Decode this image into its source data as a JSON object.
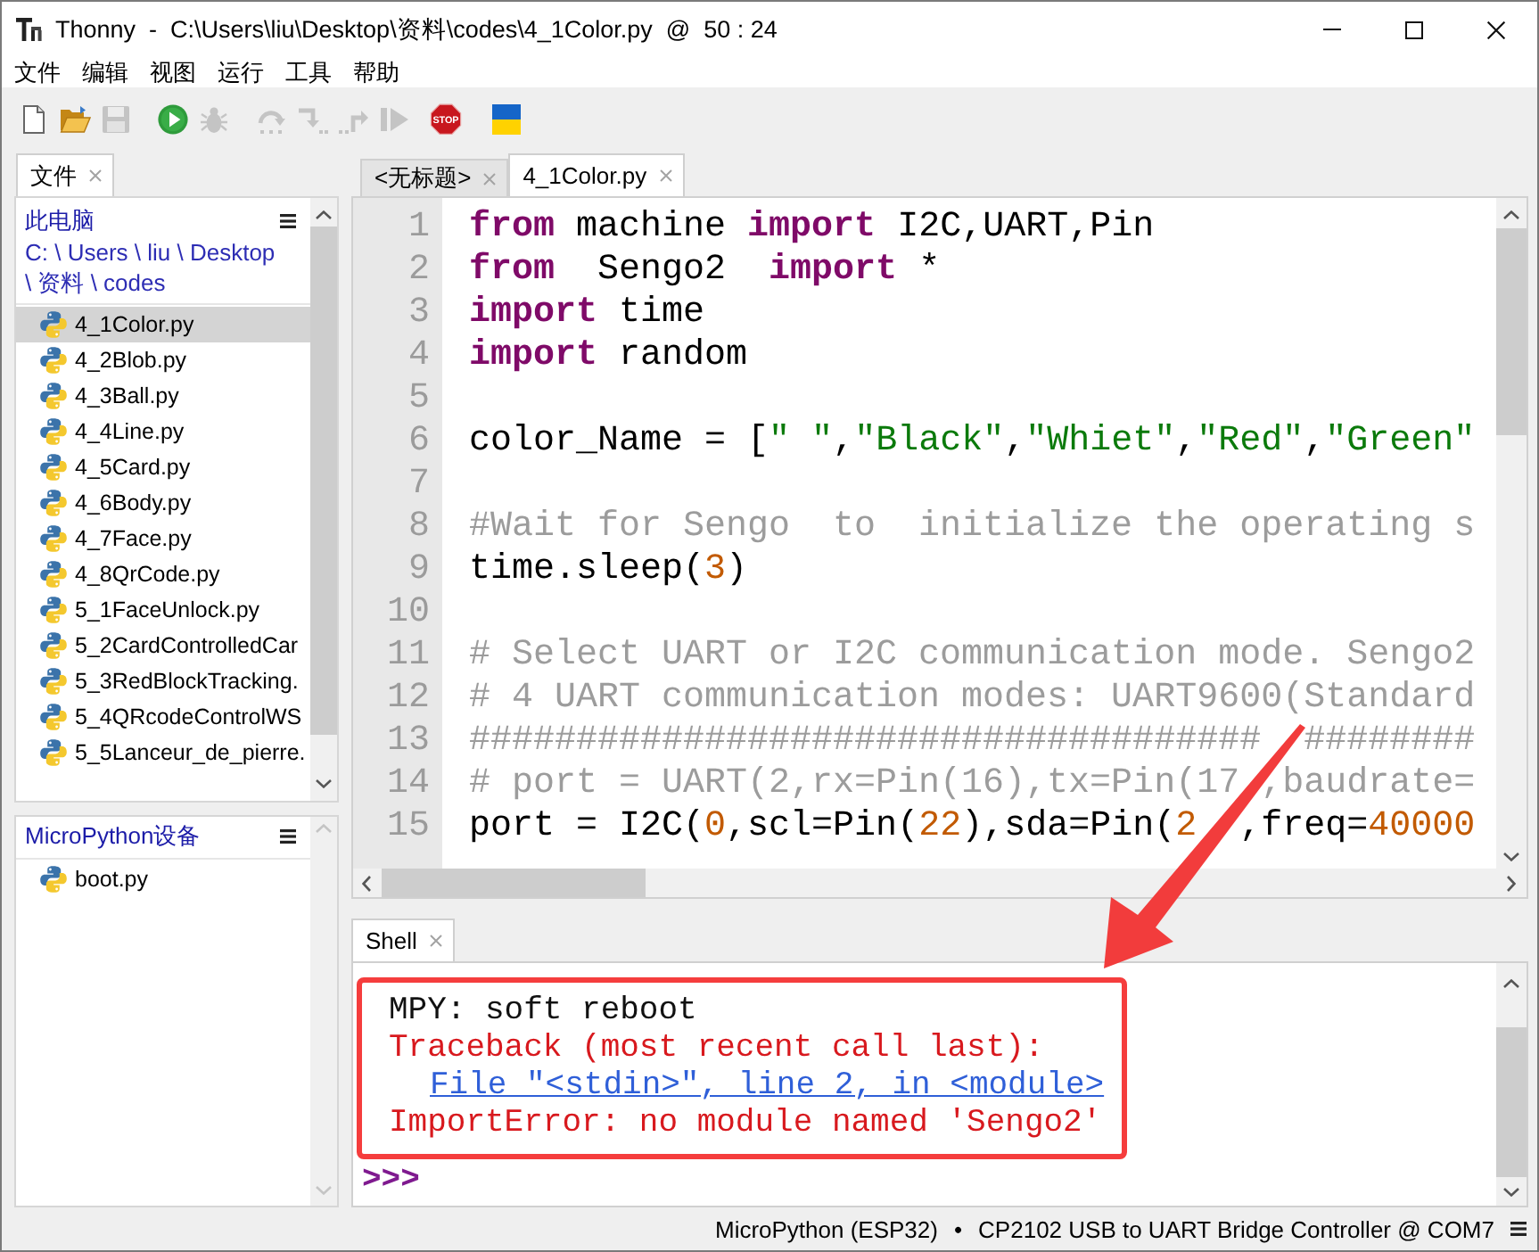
{
  "window": {
    "title": "Thonny  -  C:\\Users\\liu\\Desktop\\资料\\codes\\4_1Color.py  @  50 : 24"
  },
  "menu": [
    "文件",
    "编辑",
    "视图",
    "运行",
    "工具",
    "帮助"
  ],
  "toolbar": [
    {
      "kind": "new",
      "disabled": false
    },
    {
      "kind": "open",
      "disabled": false
    },
    {
      "kind": "save",
      "disabled": true
    },
    {
      "kind": "run",
      "disabled": false
    },
    {
      "kind": "debug",
      "disabled": true
    },
    {
      "kind": "step_over",
      "disabled": true
    },
    {
      "kind": "step_into",
      "disabled": true
    },
    {
      "kind": "step_out",
      "disabled": true
    },
    {
      "kind": "resume",
      "disabled": true
    },
    {
      "kind": "stop",
      "disabled": false,
      "label": "STOP"
    },
    {
      "kind": "flag",
      "disabled": false
    }
  ],
  "files_panel": {
    "tab": {
      "label": "文件",
      "selected": true
    },
    "header": "此电脑",
    "path_lines": [
      "C: \\ Users \\ liu \\ Desktop",
      "\\ 资料 \\ codes"
    ],
    "items": [
      {
        "name": "4_1Color.py",
        "selected": true
      },
      {
        "name": "4_2Blob.py",
        "selected": false
      },
      {
        "name": "4_3Ball.py",
        "selected": false
      },
      {
        "name": "4_4Line.py",
        "selected": false
      },
      {
        "name": "4_5Card.py",
        "selected": false
      },
      {
        "name": "4_6Body.py",
        "selected": false
      },
      {
        "name": "4_7Face.py",
        "selected": false
      },
      {
        "name": "4_8QrCode.py",
        "selected": false
      },
      {
        "name": "5_1FaceUnlock.py",
        "selected": false
      },
      {
        "name": "5_2CardControlledCar",
        "selected": false
      },
      {
        "name": "5_3RedBlockTracking.",
        "selected": false
      },
      {
        "name": "5_4QRcodeControlWS",
        "selected": false
      },
      {
        "name": "5_5Lanceur_de_pierre.",
        "selected": false
      }
    ]
  },
  "device_panel": {
    "header": "MicroPython设备",
    "items": [
      {
        "name": "boot.py",
        "selected": false
      }
    ]
  },
  "editor": {
    "tabs": [
      {
        "label": "<无标题>",
        "selected": false
      },
      {
        "label": "4_1Color.py",
        "selected": true
      }
    ],
    "lines": [
      {
        "number": "1",
        "tokens": [
          {
            "kind": "keyword",
            "text": "from"
          },
          {
            "kind": "plain",
            "text": " machine "
          },
          {
            "kind": "keyword",
            "text": "import"
          },
          {
            "kind": "plain",
            "text": " I2C,UART,Pin"
          }
        ]
      },
      {
        "number": "2",
        "tokens": [
          {
            "kind": "keyword",
            "text": "from"
          },
          {
            "kind": "plain",
            "text": "  Sengo2  "
          },
          {
            "kind": "keyword",
            "text": "import"
          },
          {
            "kind": "plain",
            "text": " *"
          }
        ]
      },
      {
        "number": "3",
        "tokens": [
          {
            "kind": "keyword",
            "text": "import"
          },
          {
            "kind": "plain",
            "text": " time"
          }
        ]
      },
      {
        "number": "4",
        "tokens": [
          {
            "kind": "keyword",
            "text": "import"
          },
          {
            "kind": "plain",
            "text": " random"
          }
        ]
      },
      {
        "number": "5"
      },
      {
        "number": "6",
        "tokens": [
          {
            "kind": "plain",
            "text": "color_Name = ["
          },
          {
            "kind": "string",
            "text": "\" \""
          },
          {
            "kind": "plain",
            "text": ","
          },
          {
            "kind": "string",
            "text": "\"Black\""
          },
          {
            "kind": "plain",
            "text": ","
          },
          {
            "kind": "string",
            "text": "\"Whiet\""
          },
          {
            "kind": "plain",
            "text": ","
          },
          {
            "kind": "string",
            "text": "\"Red\""
          },
          {
            "kind": "plain",
            "text": ","
          },
          {
            "kind": "string",
            "text": "\"Green\""
          }
        ]
      },
      {
        "number": "7"
      },
      {
        "number": "8",
        "tokens": [
          {
            "kind": "comment",
            "text": "#Wait for Sengo  to  initialize the operating s"
          }
        ]
      },
      {
        "number": "9",
        "tokens": [
          {
            "kind": "plain",
            "text": "time.sleep("
          },
          {
            "kind": "number",
            "text": "3"
          },
          {
            "kind": "plain",
            "text": ")"
          }
        ]
      },
      {
        "number": "10"
      },
      {
        "number": "11",
        "tokens": [
          {
            "kind": "comment",
            "text": "# Select UART or I2C communication mode. Sengo2"
          }
        ]
      },
      {
        "number": "12",
        "tokens": [
          {
            "kind": "comment",
            "text": "# 4 UART communication modes: UART9600(Standard"
          }
        ]
      },
      {
        "number": "13",
        "tokens": [
          {
            "kind": "comment",
            "text": "#####################################  ########"
          }
        ]
      },
      {
        "number": "14",
        "tokens": [
          {
            "kind": "comment",
            "text": "# port = UART(2,rx=Pin(16),tx=Pin(17 ,baudrate="
          }
        ]
      },
      {
        "number": "15",
        "tokens": [
          {
            "kind": "plain",
            "text": "port = I2C("
          },
          {
            "kind": "number",
            "text": "0"
          },
          {
            "kind": "plain",
            "text": ",scl=Pin("
          },
          {
            "kind": "number",
            "text": "22"
          },
          {
            "kind": "plain",
            "text": "),sda=Pin("
          },
          {
            "kind": "number",
            "text": "2"
          },
          {
            "kind": "plain",
            "text": "  ,freq="
          },
          {
            "kind": "number",
            "text": "40000"
          }
        ]
      }
    ]
  },
  "shell": {
    "tab": {
      "label": "Shell",
      "selected": true
    },
    "highlighted": true,
    "lines": [
      {
        "kind": "output",
        "text": "MPY: soft reboot"
      },
      {
        "kind": "error",
        "text": "Traceback (most recent call last):"
      },
      {
        "kind": "link",
        "text": "File \"<stdin>\", line 2, in <module>"
      },
      {
        "kind": "error",
        "text": "ImportError: no module named 'Sengo2'"
      }
    ],
    "prompt": ">>>"
  },
  "status_bar": {
    "interpreter": "MicroPython (ESP32)",
    "separator": "•",
    "port": "CP2102 USB to UART Bridge Controller @ COM7"
  }
}
